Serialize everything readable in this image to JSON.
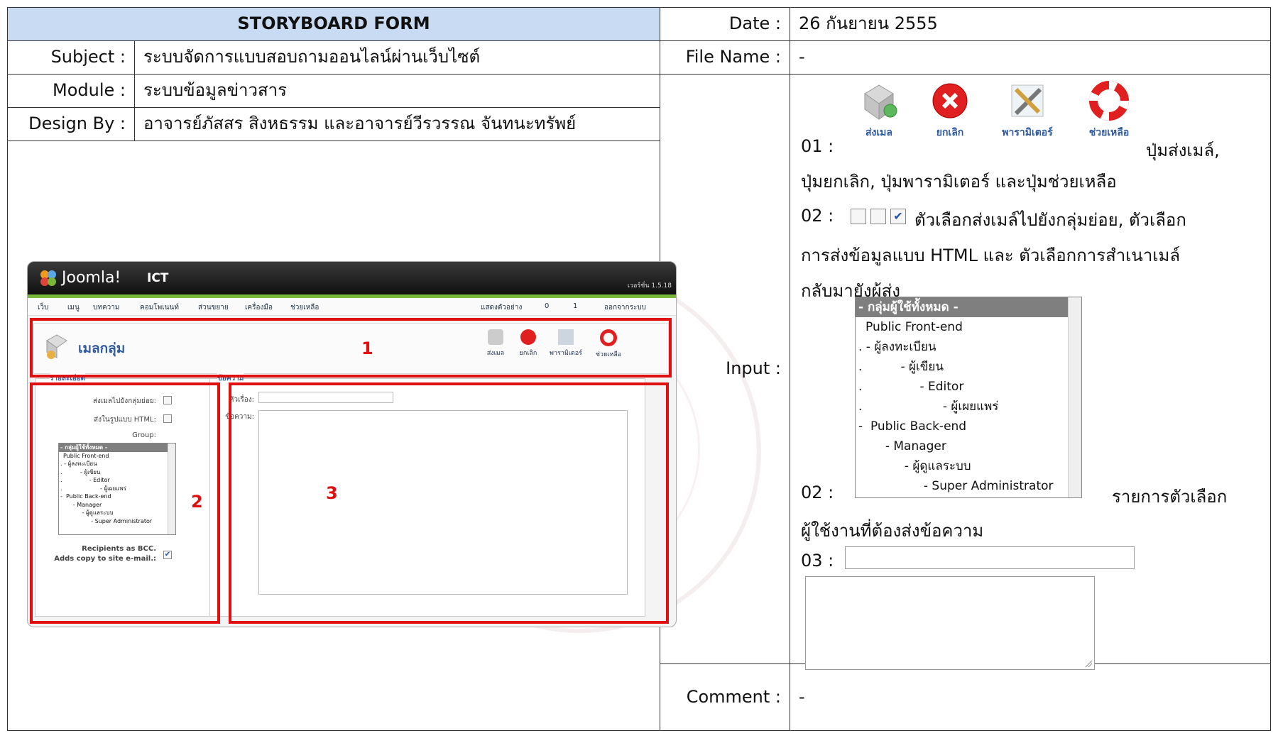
{
  "form": {
    "title": "STORYBOARD FORM",
    "date_label": "Date :",
    "date_value": "26 กันยายน 2555",
    "subject_label": "Subject :",
    "subject_value": "ระบบจัดการแบบสอบถามออนไลน์ผ่านเว็บไซต์",
    "filename_label": "File Name :",
    "filename_value": "-",
    "module_label": "Module :",
    "module_value": "ระบบข้อมูลข่าวสาร",
    "designby_label": "Design By :",
    "designby_value": "อาจารย์ภัสสร สิงหธรรม และอาจารย์วีรวรรณ จันทนะทรัพย์",
    "input_label": "Input :",
    "comment_label": "Comment :",
    "comment_value": "-"
  },
  "input_desc": {
    "item01_prefix": "01 :",
    "item01_text_a": "ปุ่มส่งเมล์,",
    "item01_text_b": "ปุ่มยกเลิก, ปุ่มพารามิเตอร์ และปุ่มช่วยเหลือ",
    "item02a_prefix": "02 :",
    "item02a_text_a": "ตัวเลือกส่งเมล์ไปยังกลุ่มย่อย, ตัวเลือก",
    "item02a_text_b": "การส่งข้อมูลแบบ HTML และ ตัวเลือกการสำเนาเมล์",
    "item02a_text_c": "กลับมายังผู้ส่ง",
    "item02b_prefix": "02 :",
    "item02b_text_a": "รายการตัวเลือก",
    "item02b_text_b": "ผู้ใช้งานที่ต้องส่งข้อความ",
    "item03_prefix": "03 :",
    "buttons": [
      {
        "label": "ส่งเมล",
        "icon": "send-mail-icon"
      },
      {
        "label": "ยกเลิก",
        "icon": "cancel-icon"
      },
      {
        "label": "พารามิเตอร์",
        "icon": "parameters-icon"
      },
      {
        "label": "ช่วยเหลือ",
        "icon": "help-icon"
      }
    ],
    "group_list": [
      "- กลุ่มผู้ใช้ทั้งหมด -",
      "Public Front-end",
      ". - ผู้ลงทะเบียน",
      ".          - ผู้เขียน",
      ".               - Editor",
      ".                     - ผู้เผยแพร่",
      "-  Public Back-end",
      "       - Manager",
      "            - ผู้ดูแลระบบ",
      "                 - Super Administrator"
    ]
  },
  "joomla": {
    "logo_text": "Joomla!",
    "site_name": "ICT",
    "version": "เวอร์ชั่น 1.5.18",
    "menu": [
      "เว็บ",
      "เมนู",
      "บทความ",
      "คอมโพเนนท์",
      "ส่วนขยาย",
      "เครื่องมือ",
      "ช่วยเหลือ"
    ],
    "status_preview": "แสดงตัวอย่าง",
    "status_count_a": "0",
    "status_count_b": "1",
    "status_logout": "ออกจากระบบ",
    "page_title": "เมลกลุ่ม",
    "toolbar": [
      "ส่งเมล",
      "ยกเลิก",
      "พารามิเตอร์",
      "ช่วยเหลือ"
    ],
    "details_legend": "รายละเอียด",
    "msg_legend": "ข้อความ",
    "field_subgroup": "ส่งเมลไปยังกลุ่มย่อย:",
    "field_html": "ส่งในรูปแบบ HTML:",
    "field_group": "Group:",
    "field_subject": "หัวเรื่อง:",
    "field_message": "ข้อความ:",
    "field_bcc_a": "Recipients as BCC.",
    "field_bcc_b": "Adds copy to site e-mail.:",
    "annot_1": "1",
    "annot_2": "2",
    "annot_3": "3"
  },
  "colors": {
    "header_bg": "#c9dbf3",
    "annotation_red": "#e01010"
  }
}
